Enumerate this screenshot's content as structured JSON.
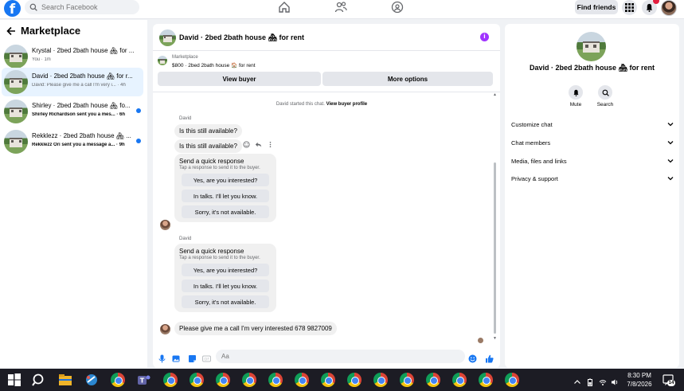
{
  "topbar": {
    "logo": "f",
    "search_placeholder": "Search Facebook",
    "find_friends": "Find friends",
    "icons": [
      "home-icon",
      "friends-icon",
      "groups-icon",
      "apps-grid-icon",
      "bell-icon"
    ]
  },
  "left": {
    "title": "Marketplace",
    "conversations": [
      {
        "title": "Krystal · 2bed 2bath house 🏘 for ...",
        "subtitle": "You · 1m",
        "unread": false,
        "active": false
      },
      {
        "title": "David · 2bed 2bath house 🏘 for r...",
        "subtitle": "David: Please give me a call I'm very i... · 4h",
        "unread": false,
        "active": true
      },
      {
        "title": "Shirley · 2bed 2bath house 🏘 fo...",
        "subtitle": "Shirley Richardson sent you a mes... · 6h",
        "unread": true,
        "active": false
      },
      {
        "title": "Rekklezz · 2bed 2bath house 🏘 ...",
        "subtitle": "Rekklezz Ori sent you a message a... · 9h",
        "unread": true,
        "active": false
      }
    ]
  },
  "chat": {
    "title": "David · 2bed 2bath house 🏘 for rent",
    "menu_icon": "i",
    "listing_label": "Marketplace",
    "listing_desc": "$800 · 2bed 2bath house 🏠 for rent",
    "view_buyer": "View buyer",
    "more_options": "More options",
    "started_text": "David started this chat.",
    "started_link": "View buyer profile",
    "sender_1": "David",
    "msg_1": "Is this still available?",
    "msg_2": "Is this still available?",
    "quick_1": {
      "title": "Send a quick response",
      "subtitle": "Tap a response to send it to the buyer.",
      "options": [
        "Yes, are you interested?",
        "In talks. I'll let you know.",
        "Sorry, it's not available."
      ]
    },
    "sender_2": "David",
    "quick_2": {
      "title": "Send a quick response",
      "subtitle": "Tap a response to send it to the buyer.",
      "options": [
        "Yes, are you interested?",
        "In talks. I'll let you know.",
        "Sorry, it's not available."
      ]
    },
    "msg_3": "Please give me a call I'm very interested 678 9827009",
    "composer_placeholder": "Aa"
  },
  "right": {
    "title": "David · 2bed 2bath house 🏘 for rent",
    "actions": [
      {
        "label": "Mute",
        "icon": "bell-icon"
      },
      {
        "label": "Search",
        "icon": "search-icon"
      }
    ],
    "sections": [
      "Customize chat",
      "Chat members",
      "Media, files and links",
      "Privacy & support"
    ]
  },
  "taskbar": {
    "time": "8:30 PM",
    "date": "7/8/2026",
    "notification_count": "14"
  },
  "colors": {
    "brand": "#1877f2",
    "active_conv": "#e7f3ff",
    "unread_dot": "#1877f2",
    "page_bg": "#f0f2f5"
  }
}
